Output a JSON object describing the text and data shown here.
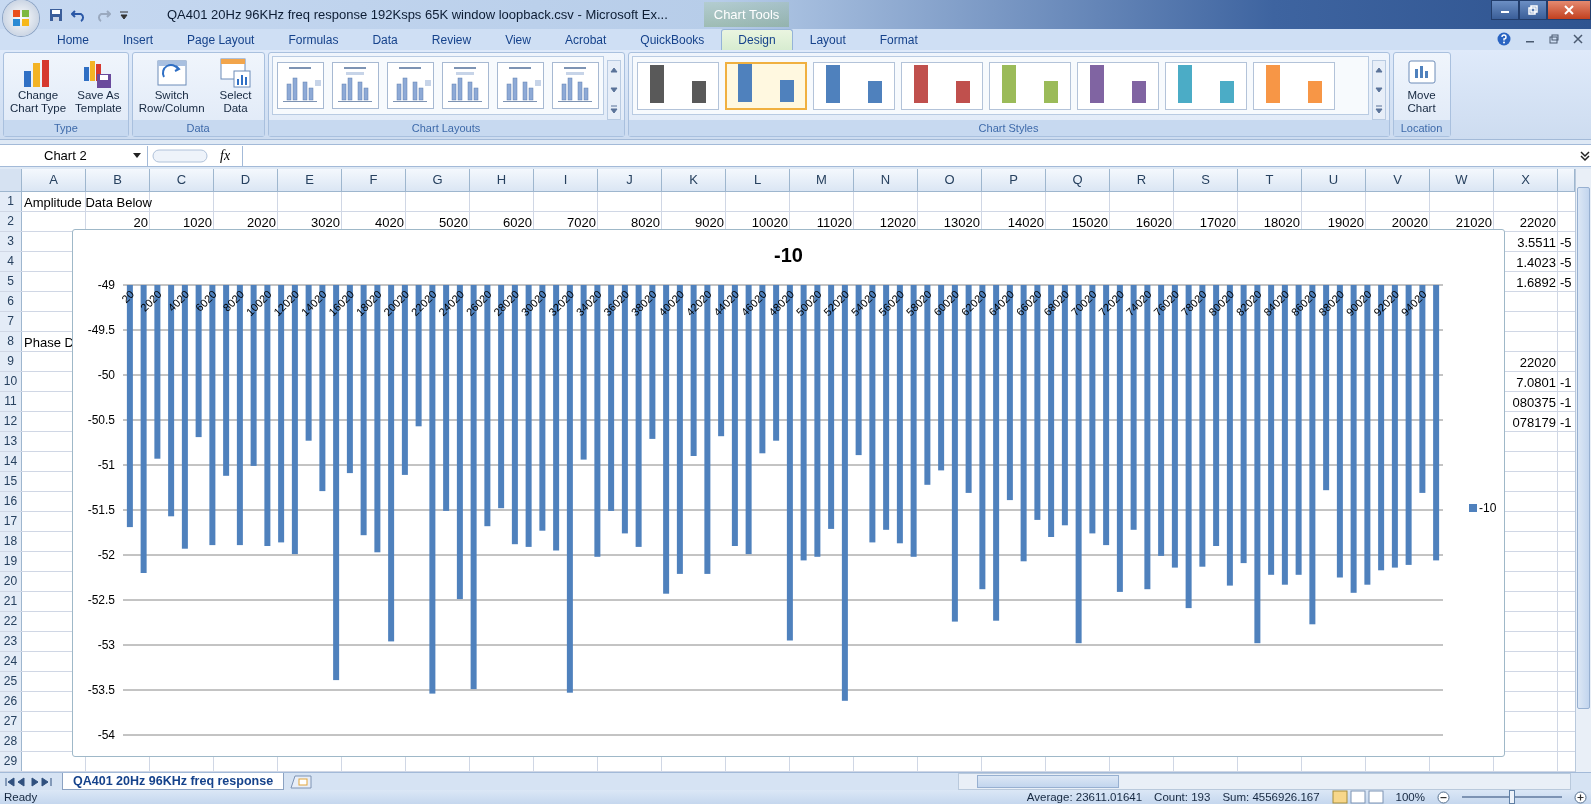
{
  "title_bar": {
    "title": "QA401 20Hz 96KHz freq response 192Ksps 65K window loopback.csv - Microsoft Ex...",
    "context": "Chart Tools"
  },
  "ribbon_tabs": [
    {
      "label": "Home",
      "selected": false
    },
    {
      "label": "Insert",
      "selected": false
    },
    {
      "label": "Page Layout",
      "selected": false
    },
    {
      "label": "Formulas",
      "selected": false
    },
    {
      "label": "Data",
      "selected": false
    },
    {
      "label": "Review",
      "selected": false
    },
    {
      "label": "View",
      "selected": false
    },
    {
      "label": "Acrobat",
      "selected": false
    },
    {
      "label": "QuickBooks",
      "selected": false
    },
    {
      "label": "Design",
      "selected": true
    },
    {
      "label": "Layout",
      "selected": false
    },
    {
      "label": "Format",
      "selected": false
    }
  ],
  "ribbon_groups": [
    {
      "title": "Type",
      "kind": "buttons",
      "buttons": [
        {
          "kind": "change-type",
          "lines": [
            "Change",
            "Chart Type"
          ]
        },
        {
          "kind": "save-template",
          "lines": [
            "Save As",
            "Template"
          ]
        }
      ]
    },
    {
      "title": "Data",
      "kind": "buttons",
      "buttons": [
        {
          "kind": "switch",
          "lines": [
            "Switch",
            "Row/Column"
          ]
        },
        {
          "kind": "select-data",
          "lines": [
            "Select",
            "Data"
          ]
        }
      ]
    },
    {
      "title": "Chart Layouts",
      "kind": "layouts"
    },
    {
      "title": "Chart Styles",
      "kind": "styles",
      "styles": [
        {
          "color": "#595959",
          "selected": false
        },
        {
          "color": "#4f81bd",
          "selected": true
        },
        {
          "color": "#4f81bd",
          "selected": false
        },
        {
          "color": "#c0504d",
          "selected": false
        },
        {
          "color": "#9bbb59",
          "selected": false
        },
        {
          "color": "#8064a2",
          "selected": false
        },
        {
          "color": "#4bacc6",
          "selected": false
        },
        {
          "color": "#f79646",
          "selected": false
        }
      ]
    },
    {
      "title": "Location",
      "kind": "buttons",
      "buttons": [
        {
          "kind": "move",
          "lines": [
            "Move",
            "Chart"
          ]
        }
      ]
    }
  ],
  "formula_bar": {
    "name_box": "Chart 2",
    "function_label": "fx"
  },
  "sheet": {
    "columns": [
      "A",
      "B",
      "C",
      "D",
      "E",
      "F",
      "G",
      "H",
      "I",
      "J",
      "K",
      "L",
      "M",
      "N",
      "O",
      "P",
      "Q",
      "R",
      "S",
      "T",
      "U",
      "V",
      "W",
      "X"
    ],
    "rows": [
      {
        "number": "1",
        "cells": [
          "Amplitude Data Below"
        ]
      },
      {
        "number": "2",
        "cells": [
          null,
          "20",
          "1020",
          "2020",
          "3020",
          "4020",
          "5020",
          "6020",
          "7020",
          "8020",
          "9020",
          "10020",
          "11020",
          "12020",
          "13020",
          "14020",
          "15020",
          "16020",
          "17020",
          "18020",
          "19020",
          "20020",
          "21020",
          "22020"
        ]
      },
      {
        "number": "3",
        "cells": [
          null,
          null,
          null,
          null,
          null,
          null,
          null,
          null,
          null,
          null,
          null,
          null,
          null,
          null,
          null,
          null,
          null,
          null,
          null,
          null,
          null,
          null,
          null,
          "3.5511",
          "-5"
        ]
      },
      {
        "number": "4",
        "cells": [
          null,
          null,
          null,
          null,
          null,
          null,
          null,
          null,
          null,
          null,
          null,
          null,
          null,
          null,
          null,
          null,
          null,
          null,
          null,
          null,
          null,
          null,
          null,
          "1.4023",
          "-5"
        ]
      },
      {
        "number": "5",
        "cells": [
          null,
          null,
          null,
          null,
          null,
          null,
          null,
          null,
          null,
          null,
          null,
          null,
          null,
          null,
          null,
          null,
          null,
          null,
          null,
          null,
          null,
          null,
          null,
          "1.6892",
          "-5"
        ]
      },
      {
        "number": "6"
      },
      {
        "number": "7"
      },
      {
        "number": "8",
        "cells": [
          "Phase D"
        ]
      },
      {
        "number": "9",
        "cells": [
          null,
          null,
          null,
          null,
          null,
          null,
          null,
          null,
          null,
          null,
          null,
          null,
          null,
          null,
          null,
          null,
          null,
          null,
          null,
          null,
          null,
          null,
          null,
          "22020"
        ]
      },
      {
        "number": "10",
        "cells": [
          null,
          null,
          null,
          null,
          null,
          null,
          null,
          null,
          null,
          null,
          null,
          null,
          null,
          null,
          null,
          null,
          null,
          null,
          null,
          null,
          null,
          null,
          null,
          "7.0801",
          "-1"
        ]
      },
      {
        "number": "11",
        "cells": [
          null,
          null,
          null,
          null,
          null,
          null,
          null,
          null,
          null,
          null,
          null,
          null,
          null,
          null,
          null,
          null,
          null,
          null,
          null,
          null,
          null,
          null,
          null,
          "080375",
          "-1"
        ]
      },
      {
        "number": "12",
        "cells": [
          null,
          null,
          null,
          null,
          null,
          null,
          null,
          null,
          null,
          null,
          null,
          null,
          null,
          null,
          null,
          null,
          null,
          null,
          null,
          null,
          null,
          null,
          null,
          "078179",
          "-1"
        ]
      },
      {
        "number": "13"
      },
      {
        "number": "14"
      },
      {
        "number": "15"
      },
      {
        "number": "16"
      },
      {
        "number": "17"
      },
      {
        "number": "18"
      },
      {
        "number": "19"
      },
      {
        "number": "20"
      },
      {
        "number": "21"
      },
      {
        "number": "22"
      },
      {
        "number": "23"
      },
      {
        "number": "24"
      },
      {
        "number": "25"
      },
      {
        "number": "26"
      },
      {
        "number": "27"
      },
      {
        "number": "28"
      },
      {
        "number": "29"
      }
    ]
  },
  "chart": {
    "chart_data": {
      "type": "bar",
      "title": "-10",
      "grid": true,
      "xlim": [
        20,
        95020
      ],
      "ylim": [
        -54,
        -49
      ],
      "yticks": [
        -49,
        -49.5,
        -50,
        -50.5,
        -51,
        -51.5,
        -52,
        -52.5,
        -53,
        -53.5,
        -54
      ],
      "x": [
        20,
        1020,
        2020,
        3020,
        4020,
        5020,
        6020,
        7020,
        8020,
        9020,
        10020,
        11020,
        12020,
        13020,
        14020,
        15020,
        16020,
        17020,
        18020,
        19020,
        20020,
        21020,
        22020,
        23020,
        24020,
        25020,
        26020,
        27020,
        28020,
        29020,
        30020,
        31020,
        32020,
        33020,
        34020,
        35020,
        36020,
        37020,
        38020,
        39020,
        40020,
        41020,
        42020,
        43020,
        44020,
        45020,
        46020,
        47020,
        48020,
        49020,
        50020,
        51020,
        52020,
        53020,
        54020,
        55020,
        56020,
        57020,
        58020,
        59020,
        60020,
        61020,
        62020,
        63020,
        64020,
        65020,
        66020,
        67020,
        68020,
        69020,
        70020,
        71020,
        72020,
        73020,
        74020,
        75020,
        76020,
        77020,
        78020,
        79020,
        80020,
        81020,
        82020,
        83020,
        84020,
        85020,
        86020,
        87020,
        88020,
        89020,
        90020,
        91020,
        92020,
        93020,
        94020,
        95020
      ],
      "xticks": [
        20,
        2020,
        4020,
        6020,
        8020,
        10020,
        12020,
        14020,
        16020,
        18020,
        20020,
        22020,
        24020,
        26020,
        28020,
        30020,
        32020,
        34020,
        36020,
        38020,
        40020,
        42020,
        44020,
        46020,
        48020,
        50020,
        52020,
        54020,
        56020,
        58020,
        60020,
        62020,
        64020,
        66020,
        68020,
        70020,
        72020,
        74020,
        76020,
        78020,
        80020,
        82020,
        84020,
        86020,
        88020,
        90020,
        92020,
        94020
      ],
      "series": [
        {
          "name": "-10",
          "color": "#4f81bd",
          "values": [
            -51.69,
            -52.2,
            -50.93,
            -51.57,
            -51.93,
            -50.69,
            -51.89,
            -51.12,
            -51.89,
            -51.01,
            -51.9,
            -51.86,
            -51.99,
            -50.73,
            -51.29,
            -53.39,
            -51.09,
            -51.78,
            -51.97,
            -52.96,
            -51.11,
            -50.57,
            -53.54,
            -51.51,
            -52.49,
            -53.49,
            -51.68,
            -51.48,
            -51.88,
            -51.91,
            -51.73,
            -51.95,
            -53.53,
            -50.94,
            -52.02,
            -51.51,
            -51.76,
            -51.91,
            -50.71,
            -52.43,
            -52.21,
            -50.9,
            -52.21,
            -50.68,
            -51.9,
            -51.99,
            -50.87,
            -50.73,
            -52.95,
            -52.06,
            -52.02,
            -51.71,
            -53.62,
            -50.89,
            -51.86,
            -51.72,
            -51.87,
            -52.02,
            -51.22,
            -51.06,
            -52.74,
            -51.31,
            -52.38,
            -52.73,
            -51.39,
            -52.07,
            -51.61,
            -51.8,
            -51.67,
            -52.98,
            -51.76,
            -51.89,
            -52.41,
            -51.72,
            -52.38,
            -52.01,
            -52.14,
            -52.59,
            -52.13,
            -51.9,
            -52.34,
            -52.09,
            -52.98,
            -52.22,
            -52.33,
            -52.22,
            -52.77,
            -51.28,
            -52.25,
            -52.42,
            -52.33,
            -52.17,
            -52.14,
            -52.11,
            -51.31,
            -52.06
          ]
        }
      ]
    }
  },
  "sheet_tabs": [
    {
      "label": "QA401 20Hz 96KHz freq response",
      "selected": true
    }
  ],
  "status_bar": {
    "mode": "Ready",
    "average": "Average: 23611.01641",
    "count": "Count: 193",
    "sum": "Sum: 4556926.167",
    "zoom": {
      "label": "100%",
      "level": 0.5
    }
  }
}
